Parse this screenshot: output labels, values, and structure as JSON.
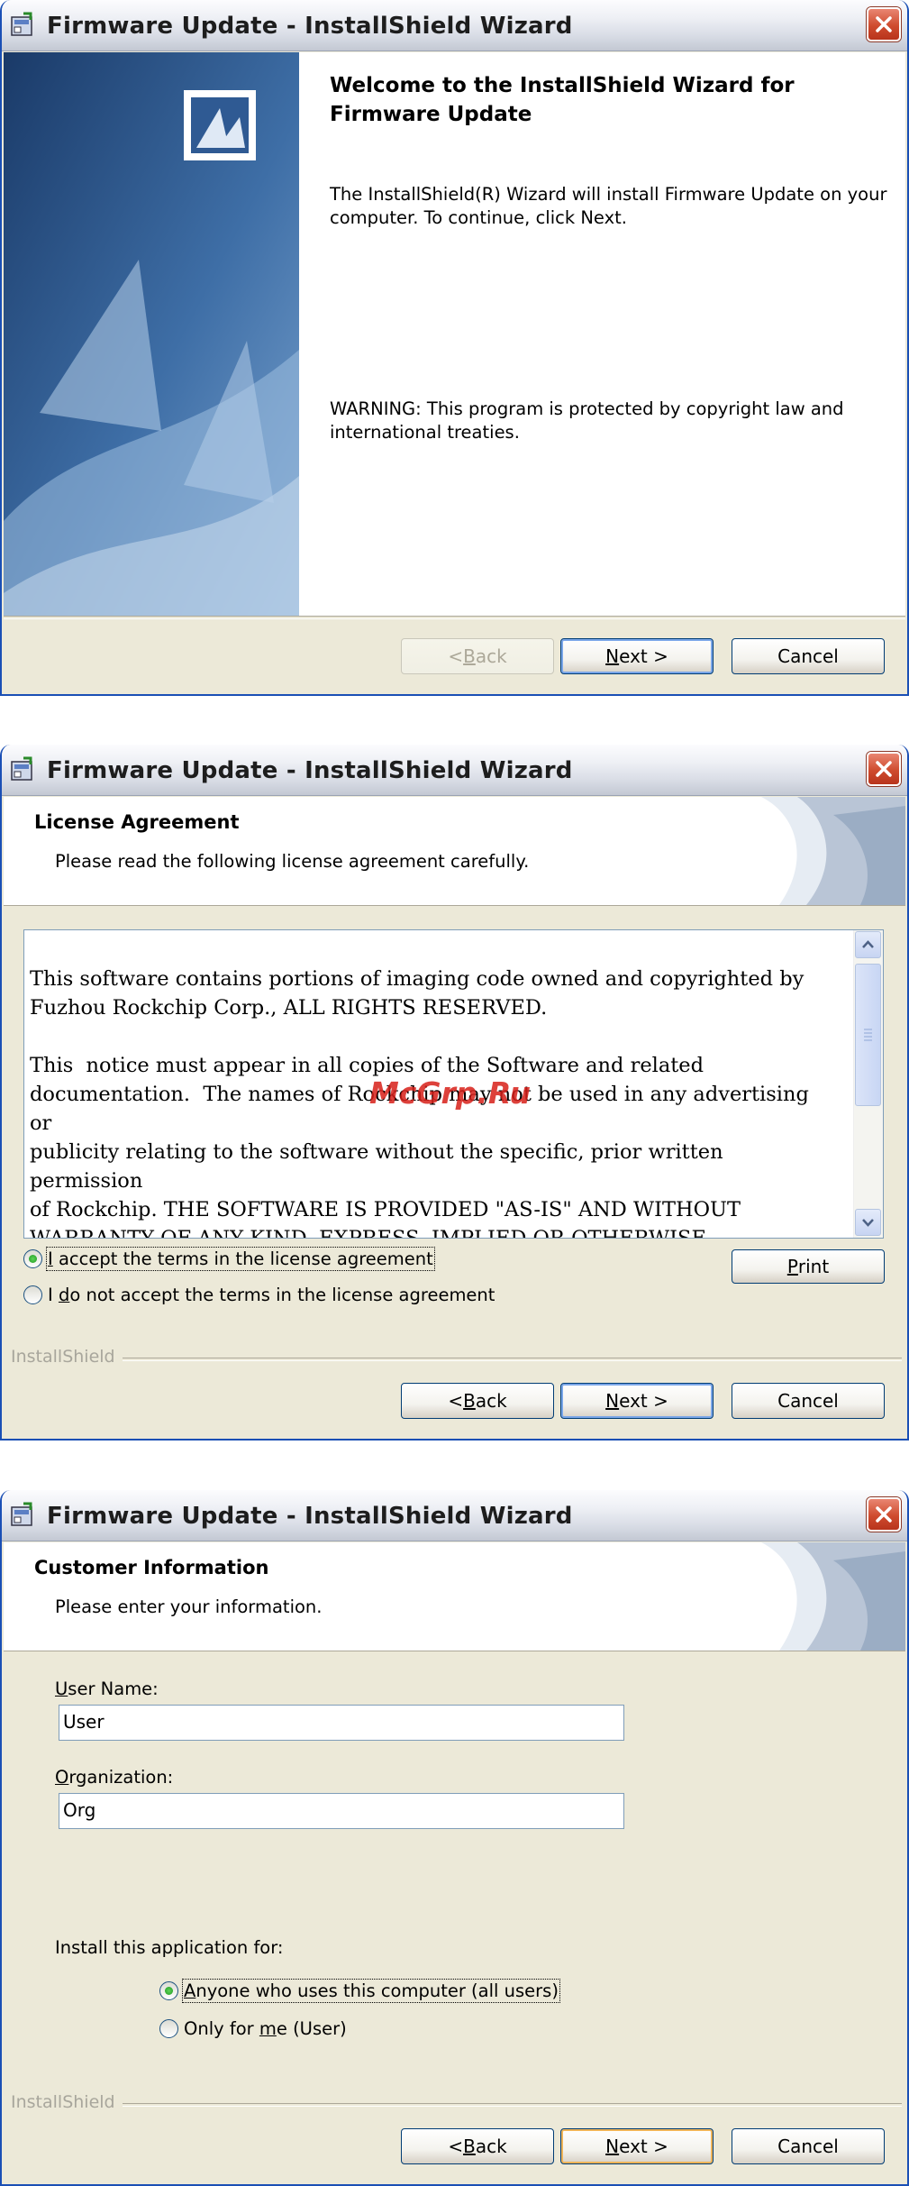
{
  "colors": {
    "title_bar": "#d9dde6",
    "dialog_bg": "#ece9d8",
    "panel_bg": "#ffffff",
    "side_art_dark": "#1e3f6e",
    "watermark": "#d8201a",
    "radio_selected": "#1f9a1f"
  },
  "welcome": {
    "title": "Firmware Update - InstallShield Wizard",
    "heading": "Welcome to the InstallShield Wizard for Firmware Update",
    "body": "The InstallShield(R) Wizard will install Firmware Update on your computer. To continue, click Next.",
    "warning": "WARNING: This program is protected by copyright law and international treaties.",
    "buttons": {
      "back": {
        "pre": "< ",
        "key": "B",
        "post": "ack",
        "enabled": false
      },
      "next": {
        "key": "N",
        "post": "ext >"
      },
      "cancel": "Cancel"
    }
  },
  "license": {
    "title": "Firmware Update - InstallShield Wizard",
    "header_title": "License Agreement",
    "header_subtitle": "Please read the following license agreement carefully.",
    "agreement_text": "This software contains portions of imaging code owned and copyrighted by\nFuzhou Rockchip Corp., ALL RIGHTS RESERVED.\n\nThis  notice must appear in all copies of the Software and related\ndocumentation.  The names of Rockchip may not be used in any advertising or\npublicity relating to the software without the specific, prior written permission\nof Rockchip. THE SOFTWARE IS PROVIDED \"AS-IS\" AND WITHOUT\nWARRANTY OF ANY KIND, EXPRESS, IMPLIED OR OTHERWISE,\nINCLUDING WITHOUT LIMITATION, ANY WARRANTY OF\nMERCHANTABILITY OR FITNESS FOR A PARTICULAR PURPOSE. IN NO",
    "watermark": "McGrp.Ru",
    "radio_accept": {
      "key": "I",
      "post": " accept the terms in the license agreement",
      "selected": true
    },
    "radio_decline": {
      "pre": "I ",
      "key": "d",
      "post": "o not accept the terms in the license agreement",
      "selected": false
    },
    "print": {
      "key": "P",
      "post": "rint"
    },
    "brand": "InstallShield",
    "buttons": {
      "back": {
        "pre": "< ",
        "key": "B",
        "post": "ack"
      },
      "next": {
        "key": "N",
        "post": "ext >"
      },
      "cancel": "Cancel"
    }
  },
  "customer": {
    "title": "Firmware Update - InstallShield Wizard",
    "header_title": "Customer Information",
    "header_subtitle": "Please enter your information.",
    "user_name_label": {
      "key": "U",
      "post": "ser Name:"
    },
    "user_name_value": "User",
    "organization_label": {
      "key": "O",
      "post": "rganization:"
    },
    "organization_value": "Org",
    "install_for_label": "Install this application for:",
    "radio_all_users": {
      "key": "A",
      "post": "nyone who uses this computer (all users)",
      "selected": true
    },
    "radio_only_me": {
      "pre": "Only for ",
      "key": "m",
      "post": "e (User)",
      "selected": false
    },
    "brand": "InstallShield",
    "buttons": {
      "back": {
        "pre": "< ",
        "key": "B",
        "post": "ack"
      },
      "next": {
        "key": "N",
        "post": "ext >"
      },
      "cancel": "Cancel"
    }
  }
}
